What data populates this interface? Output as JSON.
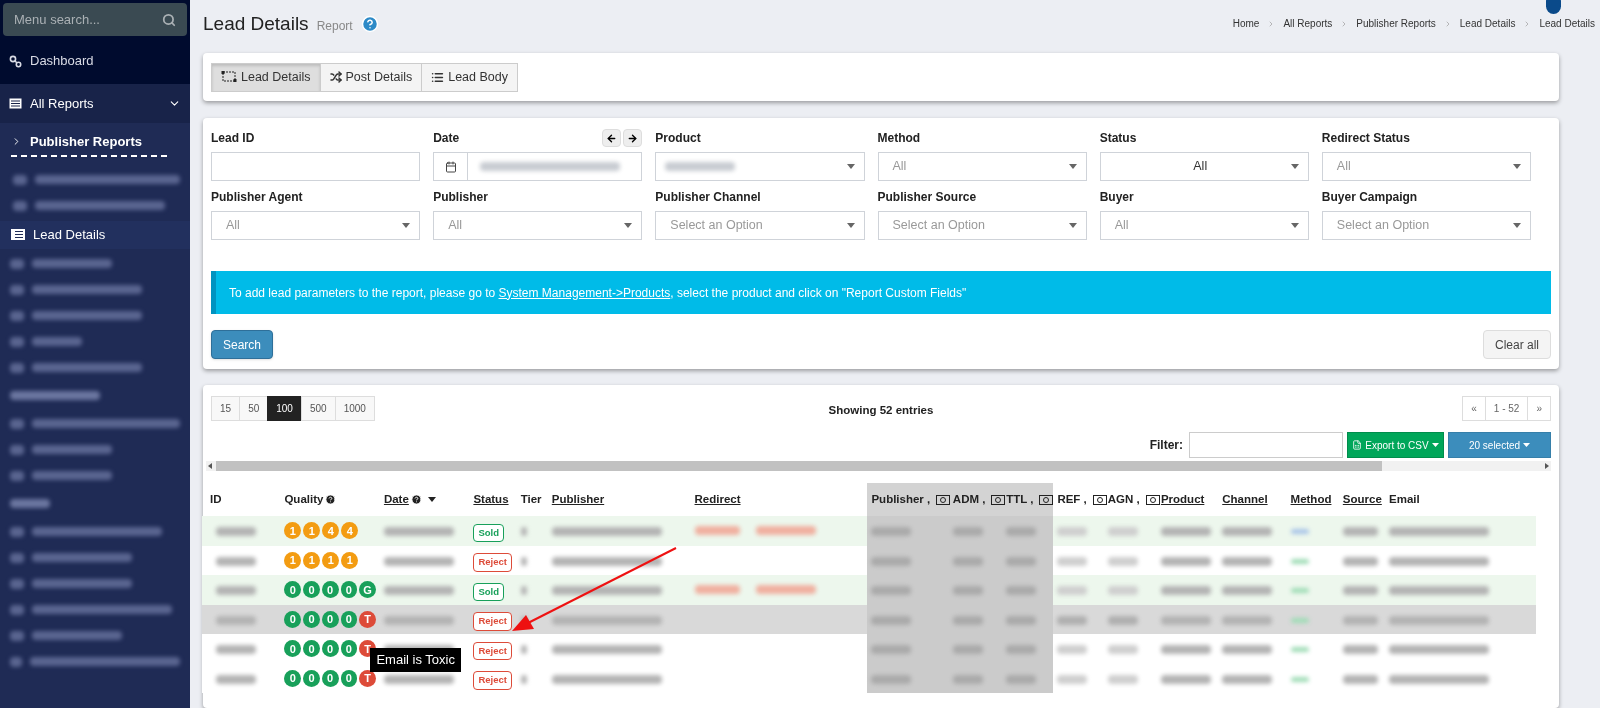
{
  "sidebar": {
    "search": {
      "placeholder": "Menu search..."
    },
    "dashboard": {
      "label": "Dashboard"
    },
    "all_reports": {
      "label": "All Reports",
      "expanded": true
    },
    "section": {
      "label": "Publisher Reports",
      "expanded": false
    },
    "active_item": {
      "label": "Lead Details",
      "selected": true
    }
  },
  "page": {
    "title": "Lead Details",
    "subtitle": "Report",
    "breadcrumbs": [
      "Home",
      "All Reports",
      "Publisher Reports",
      "Lead Details",
      "Lead Details"
    ]
  },
  "view_tabs": [
    {
      "label": "Lead Details",
      "selected": true
    },
    {
      "label": "Post Details",
      "selected": false
    },
    {
      "label": "Lead Body",
      "selected": false
    }
  ],
  "filters": [
    {
      "label": "Lead ID",
      "kind": "text"
    },
    {
      "label": "Date",
      "kind": "date"
    },
    {
      "label": "Product",
      "kind": "select",
      "redacted": true
    },
    {
      "label": "Method",
      "kind": "select",
      "placeholder": "All"
    },
    {
      "label": "Status",
      "kind": "select",
      "value": "All"
    },
    {
      "label": "Redirect Status",
      "kind": "select",
      "placeholder": "All"
    },
    {
      "label": "Publisher Agent",
      "kind": "select",
      "placeholder": "All"
    },
    {
      "label": "Publisher",
      "kind": "select",
      "placeholder": "All"
    },
    {
      "label": "Publisher Channel",
      "kind": "select",
      "placeholder": "Select an Option"
    },
    {
      "label": "Publisher Source",
      "kind": "select",
      "placeholder": "Select an Option"
    },
    {
      "label": "Buyer",
      "kind": "select",
      "placeholder": "All"
    },
    {
      "label": "Buyer Campaign",
      "kind": "select",
      "placeholder": "Select an Option"
    }
  ],
  "notice": {
    "before": "To add lead parameters to the report, please go to",
    "link": "System Management->Products",
    "after": ", select the product and click on \"Report Custom Fields\""
  },
  "search_button": "Search",
  "clear_button": "Clear all",
  "page_sizes": [
    {
      "label": "15",
      "selected": false
    },
    {
      "label": "50",
      "selected": false
    },
    {
      "label": "100",
      "selected": true
    },
    {
      "label": "500",
      "selected": false
    },
    {
      "label": "1000",
      "selected": false
    }
  ],
  "summary": "Showing 52 entries",
  "pagination": [
    "«",
    "1 - 52",
    "»"
  ],
  "filter": {
    "label": "Filter:"
  },
  "export_button": "Export to CSV",
  "columns_button": "20 selected",
  "table": {
    "columns": [
      {
        "label": "ID",
        "underlined": false
      },
      {
        "label": "Quality",
        "underlined": false,
        "help": true
      },
      {
        "label": "Date",
        "underlined": true,
        "help": true,
        "sorted": true
      },
      {
        "label": "Status",
        "underlined": true
      },
      {
        "label": "Tier",
        "underlined": false
      },
      {
        "label": "Publisher",
        "underlined": true
      },
      {
        "label": "Redirect",
        "underlined": true
      },
      {
        "label": "Publisher ,",
        "underlined": false,
        "money": true,
        "shaded": true
      },
      {
        "label": "ADM ,",
        "underlined": false,
        "money": true,
        "shaded": true
      },
      {
        "label": "TTL ,",
        "underlined": false,
        "money": true,
        "shaded": true
      },
      {
        "label": "REF ,",
        "underlined": false,
        "money": true
      },
      {
        "label": "AGN ,",
        "underlined": false,
        "money": true
      },
      {
        "label": "Product",
        "underlined": true
      },
      {
        "label": "Channel",
        "underlined": true
      },
      {
        "label": "Method",
        "underlined": true
      },
      {
        "label": "Source",
        "underlined": true
      },
      {
        "label": "Email",
        "underlined": false
      }
    ],
    "rows": [
      {
        "hovered": false,
        "status": {
          "label": "Sold",
          "kind": "sold"
        },
        "quality": [
          {
            "text": "1",
            "color": "#f39c12"
          },
          {
            "text": "1",
            "color": "#f39c12"
          },
          {
            "text": "4",
            "color": "#f39c12"
          },
          {
            "text": "4",
            "color": "#f39c12"
          }
        ]
      },
      {
        "hovered": false,
        "status": {
          "label": "Reject",
          "kind": "reject"
        },
        "quality": [
          {
            "text": "1",
            "color": "#f39c12"
          },
          {
            "text": "1",
            "color": "#f39c12"
          },
          {
            "text": "1",
            "color": "#f39c12"
          },
          {
            "text": "1",
            "color": "#f39c12"
          }
        ]
      },
      {
        "hovered": false,
        "status": {
          "label": "Sold",
          "kind": "sold"
        },
        "quality": [
          {
            "text": "0",
            "color": "#18a05a"
          },
          {
            "text": "0",
            "color": "#18a05a"
          },
          {
            "text": "0",
            "color": "#18a05a"
          },
          {
            "text": "0",
            "color": "#18a05a"
          },
          {
            "text": "G",
            "color": "#18a05a"
          }
        ]
      },
      {
        "hovered": true,
        "status": {
          "label": "Reject",
          "kind": "reject"
        },
        "quality": [
          {
            "text": "0",
            "color": "#18a05a"
          },
          {
            "text": "0",
            "color": "#18a05a"
          },
          {
            "text": "0",
            "color": "#18a05a"
          },
          {
            "text": "0",
            "color": "#18a05a"
          },
          {
            "text": "T",
            "color": "#dd4b39"
          }
        ]
      },
      {
        "hovered": false,
        "tooltip": "Email is Toxic",
        "status": {
          "label": "Reject",
          "kind": "reject"
        },
        "quality": [
          {
            "text": "0",
            "color": "#18a05a"
          },
          {
            "text": "0",
            "color": "#18a05a"
          },
          {
            "text": "0",
            "color": "#18a05a"
          },
          {
            "text": "0",
            "color": "#18a05a"
          },
          {
            "text": "T",
            "color": "#dd4b39"
          }
        ]
      },
      {
        "hovered": false,
        "status": {
          "label": "Reject",
          "kind": "reject"
        },
        "quality": [
          {
            "text": "0",
            "color": "#18a05a"
          },
          {
            "text": "0",
            "color": "#18a05a"
          },
          {
            "text": "0",
            "color": "#18a05a"
          },
          {
            "text": "0",
            "color": "#18a05a"
          },
          {
            "text": "T",
            "color": "#dd4b39"
          }
        ]
      }
    ]
  }
}
